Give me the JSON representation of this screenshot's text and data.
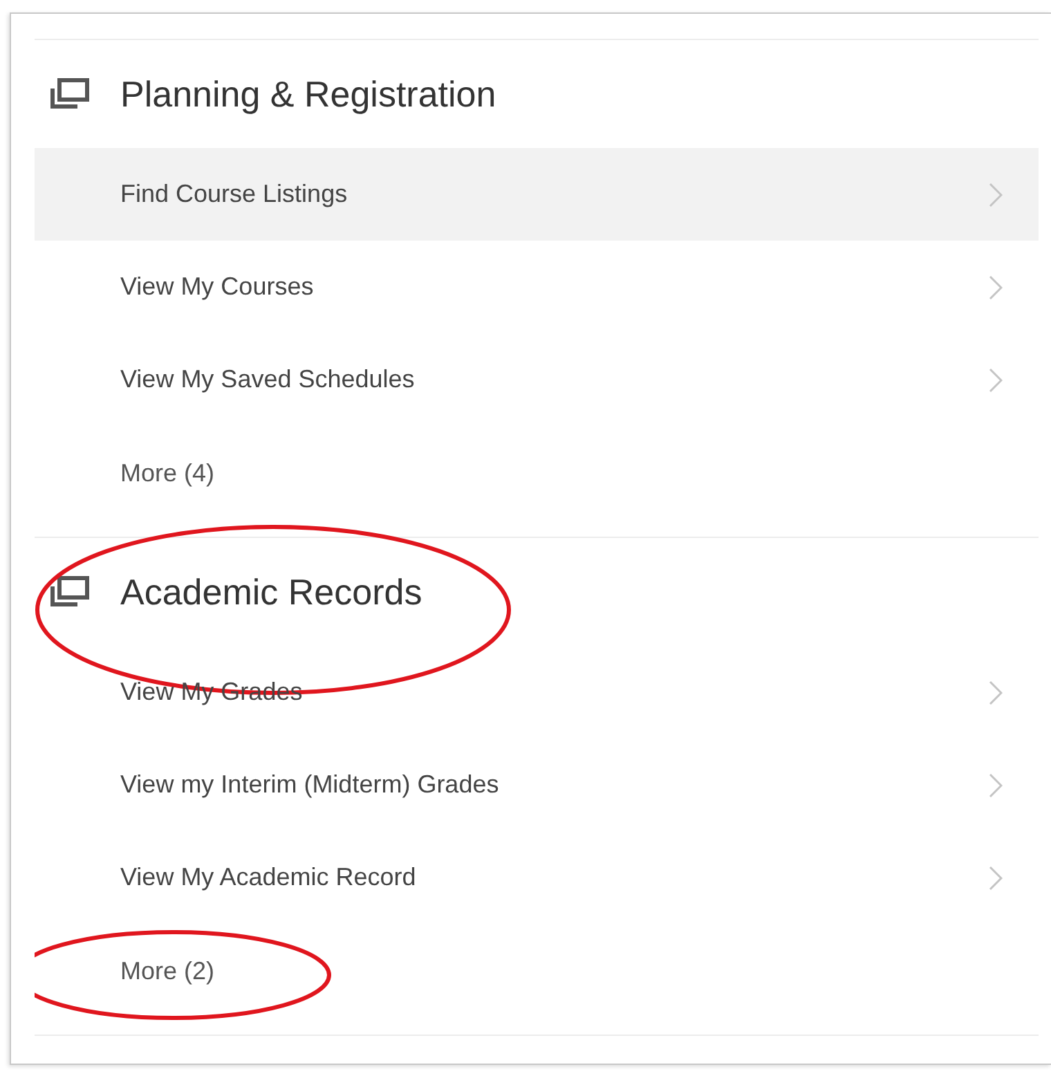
{
  "sections": [
    {
      "title": "Planning & Registration",
      "circled": false,
      "items": [
        {
          "kind": "link",
          "label": "Find Course Listings",
          "selected": true,
          "circled": false
        },
        {
          "kind": "link",
          "label": "View My Courses",
          "selected": false,
          "circled": false
        },
        {
          "kind": "link",
          "label": "View My Saved Schedules",
          "selected": false,
          "circled": false
        },
        {
          "kind": "more",
          "label": "More (4)",
          "selected": false,
          "circled": false
        }
      ]
    },
    {
      "title": "Academic Records",
      "circled": true,
      "items": [
        {
          "kind": "link",
          "label": "View My Grades",
          "selected": false,
          "circled": false
        },
        {
          "kind": "link",
          "label": "View my Interim (Midterm) Grades",
          "selected": false,
          "circled": false
        },
        {
          "kind": "link",
          "label": "View My Academic Record",
          "selected": false,
          "circled": false
        },
        {
          "kind": "more",
          "label": "More (2)",
          "selected": false,
          "circled": true
        }
      ]
    }
  ]
}
